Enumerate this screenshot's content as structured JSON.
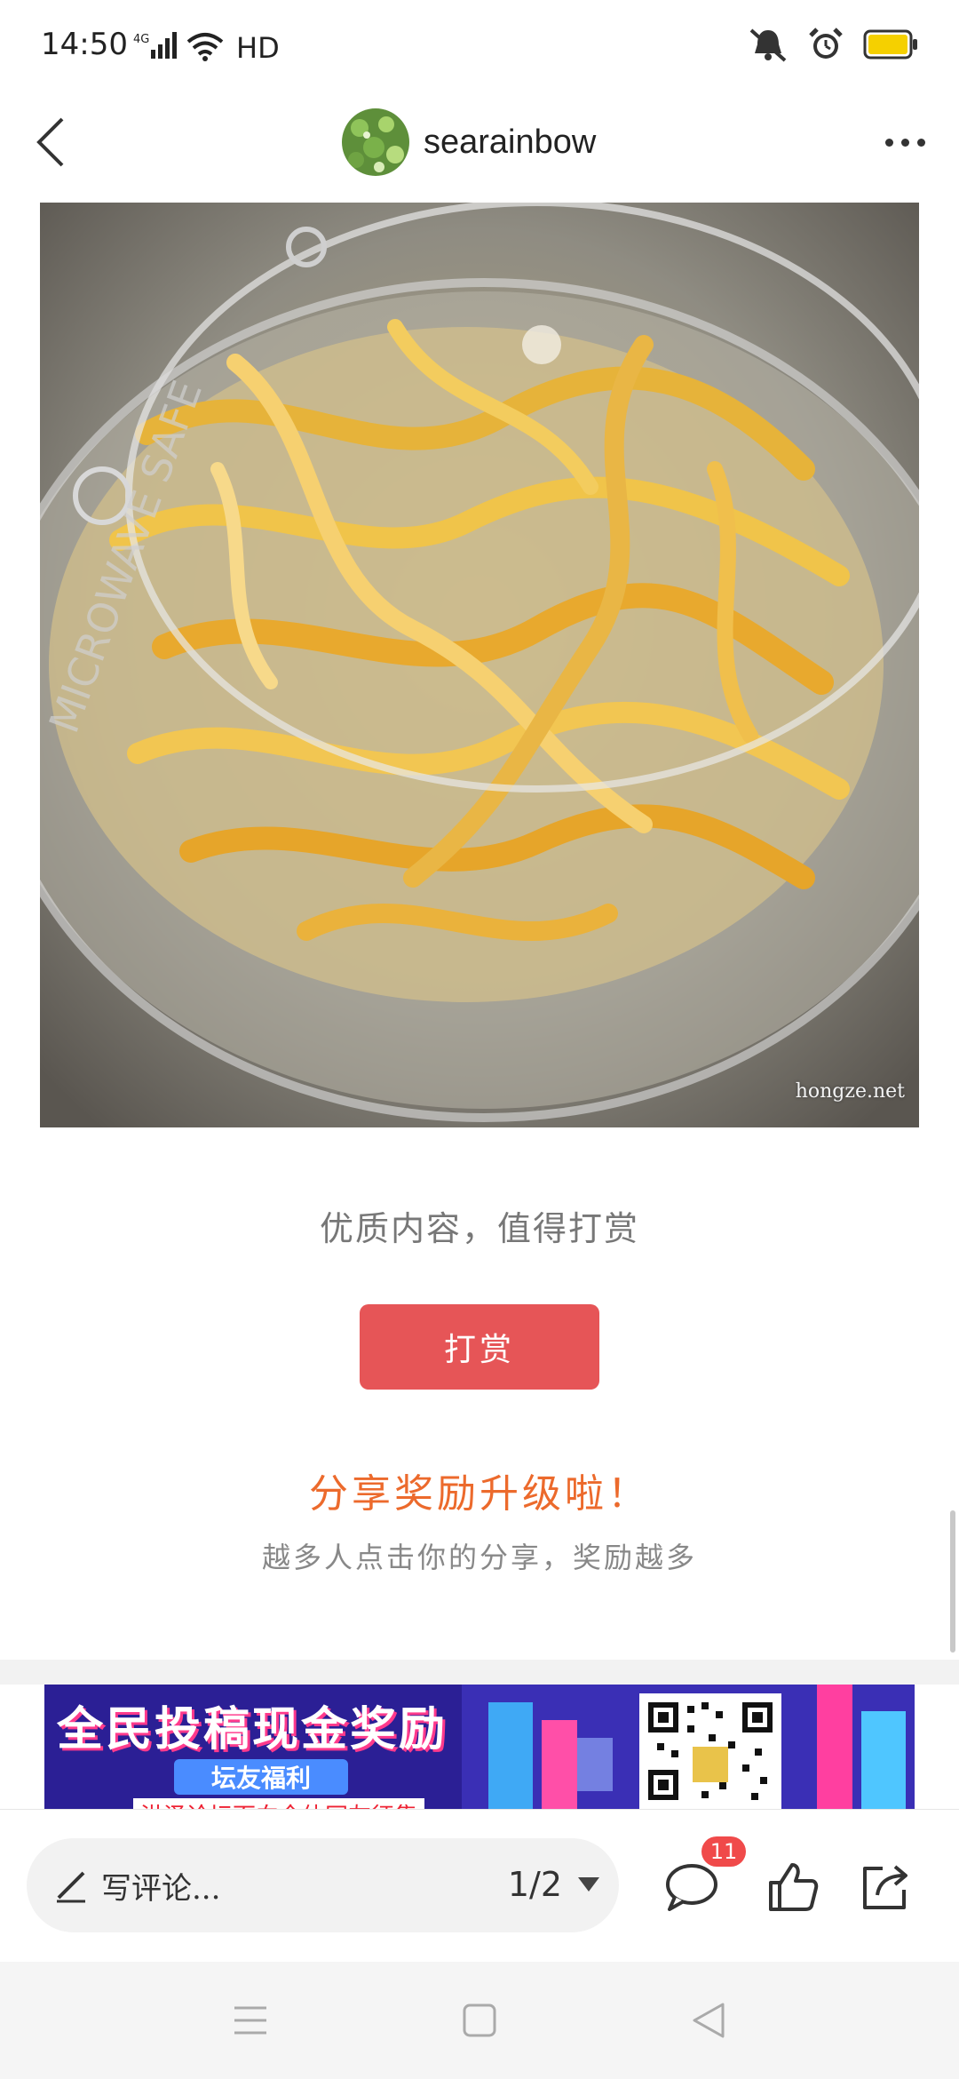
{
  "status_bar": {
    "time": "14:50",
    "network": "4G",
    "hd_label": "HD",
    "battery_color": "#f5d000"
  },
  "header": {
    "author_name": "searainbow",
    "back_icon": "chevron-left-icon",
    "more_icon": "more-horizontal-icon"
  },
  "post": {
    "image_watermark": "hongze.net"
  },
  "reward": {
    "quality_text": "优质内容，值得打赏",
    "reward_button_label": "打赏",
    "reward_button_color": "#e65557"
  },
  "share": {
    "title": "分享奖励升级啦！",
    "subtitle": "越多人点击你的分享，奖励越多",
    "title_color": "#ec6a2c"
  },
  "banner": {
    "title": "全民投稿现金奖励",
    "tag": "坛友福利",
    "subtitle": "洪泽论坛面向全体网友征集"
  },
  "bottom_bar": {
    "comment_placeholder": "写评论...",
    "page_indicator": "1/2",
    "comment_count": "11"
  }
}
